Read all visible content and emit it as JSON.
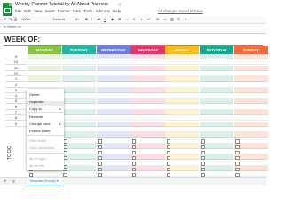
{
  "app": {
    "title": "Weekly Planner Tutorial by All About Planners",
    "menus": [
      "File",
      "Edit",
      "View",
      "Insert",
      "Format",
      "Data",
      "Tools",
      "Add-ons",
      "Help"
    ],
    "save_status": "All changes saved in Drive",
    "formula_ref": "fx  Week of:"
  },
  "toolbar": {
    "zoom": "100%",
    "font": "Default",
    "size": "10"
  },
  "planner": {
    "heading": "WEEK OF:",
    "hours": [
      "9",
      "10",
      "11",
      "12",
      "1",
      "2",
      "3",
      "4",
      "5",
      "6",
      "7",
      "8",
      "9"
    ],
    "todo_label": "TO DO",
    "days": [
      {
        "name": "MONDAY",
        "color": "#8bc34a",
        "tint": "#eaf4dc"
      },
      {
        "name": "TUESDAY",
        "color": "#26b5a4",
        "tint": "#dcf1ee"
      },
      {
        "name": "WEDNESDAY",
        "color": "#6e7fd8",
        "tint": "#e2e5f7"
      },
      {
        "name": "THURSDAY",
        "color": "#e8366a",
        "tint": "#fbdde6"
      },
      {
        "name": "FRIDAY",
        "color": "#fbbc21",
        "tint": "#fef2d2"
      },
      {
        "name": "SATURDAY",
        "color": "#1fa58c",
        "tint": "#d9efe9"
      },
      {
        "name": "SUNDAY",
        "color": "#f36e3c",
        "tint": "#fde3d7"
      }
    ]
  },
  "context_menu": {
    "items": [
      {
        "label": "Delete",
        "enabled": true,
        "submenu": false
      },
      {
        "label": "Duplicate",
        "enabled": true,
        "submenu": false
      },
      {
        "label": "Copy to",
        "enabled": true,
        "submenu": true
      },
      {
        "label": "Rename",
        "enabled": true,
        "submenu": false
      },
      {
        "label": "Change color",
        "enabled": true,
        "submenu": true
      },
      {
        "label": "Protect sheet",
        "enabled": true,
        "submenu": false
      },
      {
        "label": "Hide sheet",
        "enabled": false,
        "submenu": false
      },
      {
        "label": "View comments",
        "enabled": false,
        "submenu": false
      },
      {
        "label": "Move right",
        "enabled": false,
        "submenu": false
      },
      {
        "label": "Move left",
        "enabled": false,
        "submenu": false
      }
    ]
  },
  "sheet_tabs": {
    "active": "Template (Hourly)"
  }
}
